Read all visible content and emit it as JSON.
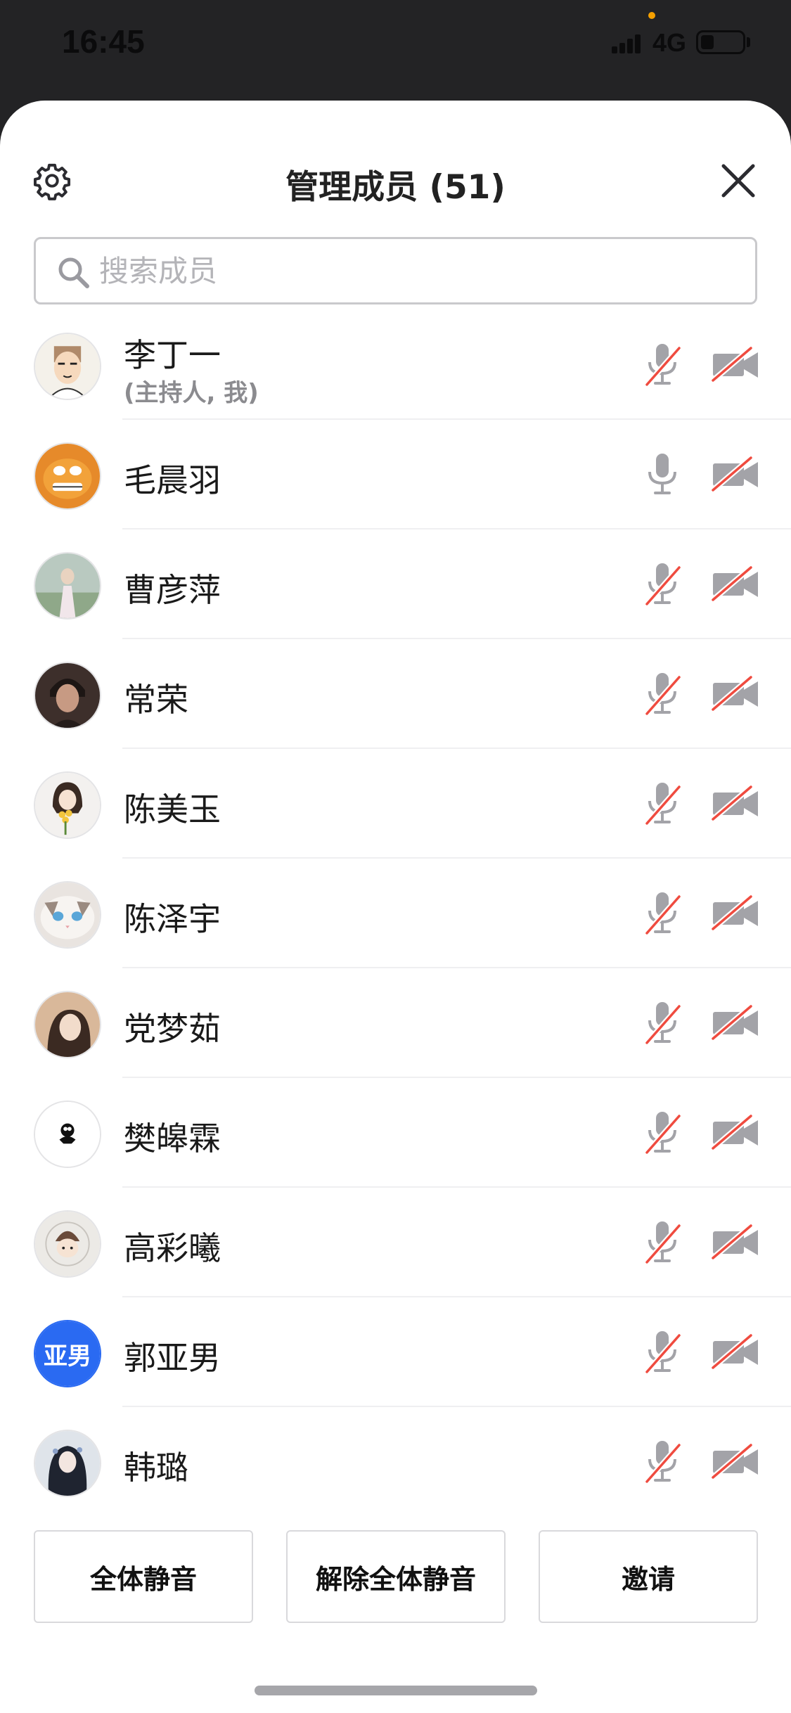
{
  "status_bar": {
    "time": "16:45",
    "network": "4G"
  },
  "header": {
    "title": "管理成员 (51)",
    "settings_icon": "gear-icon",
    "close_icon": "close-icon"
  },
  "search": {
    "placeholder": "搜索成员",
    "value": ""
  },
  "members": [
    {
      "name": "李丁一",
      "subtitle": "(主持人, 我)",
      "mic_muted": true,
      "camera_off": true
    },
    {
      "name": "毛晨羽",
      "subtitle": "",
      "mic_muted": false,
      "camera_off": true
    },
    {
      "name": "曹彦萍",
      "subtitle": "",
      "mic_muted": true,
      "camera_off": true
    },
    {
      "name": "常荣",
      "subtitle": "",
      "mic_muted": true,
      "camera_off": true
    },
    {
      "name": "陈美玉",
      "subtitle": "",
      "mic_muted": true,
      "camera_off": true
    },
    {
      "name": "陈泽宇",
      "subtitle": "",
      "mic_muted": true,
      "camera_off": true
    },
    {
      "name": "党梦茹",
      "subtitle": "",
      "mic_muted": true,
      "camera_off": true
    },
    {
      "name": "樊皞霖",
      "subtitle": "",
      "mic_muted": true,
      "camera_off": true
    },
    {
      "name": "高彩曦",
      "subtitle": "",
      "mic_muted": true,
      "camera_off": true
    },
    {
      "name": "郭亚男",
      "subtitle": "",
      "avatar_text": "亚男",
      "mic_muted": true,
      "camera_off": true
    },
    {
      "name": "韩璐",
      "subtitle": "",
      "mic_muted": true,
      "camera_off": true
    }
  ],
  "actions": {
    "mute_all": "全体静音",
    "unmute_all": "解除全体静音",
    "invite": "邀请"
  },
  "colors": {
    "muted_slash": "#ef4b3f",
    "icon_gray": "#a3a3a8",
    "avatar_blue": "#2a6af2"
  }
}
